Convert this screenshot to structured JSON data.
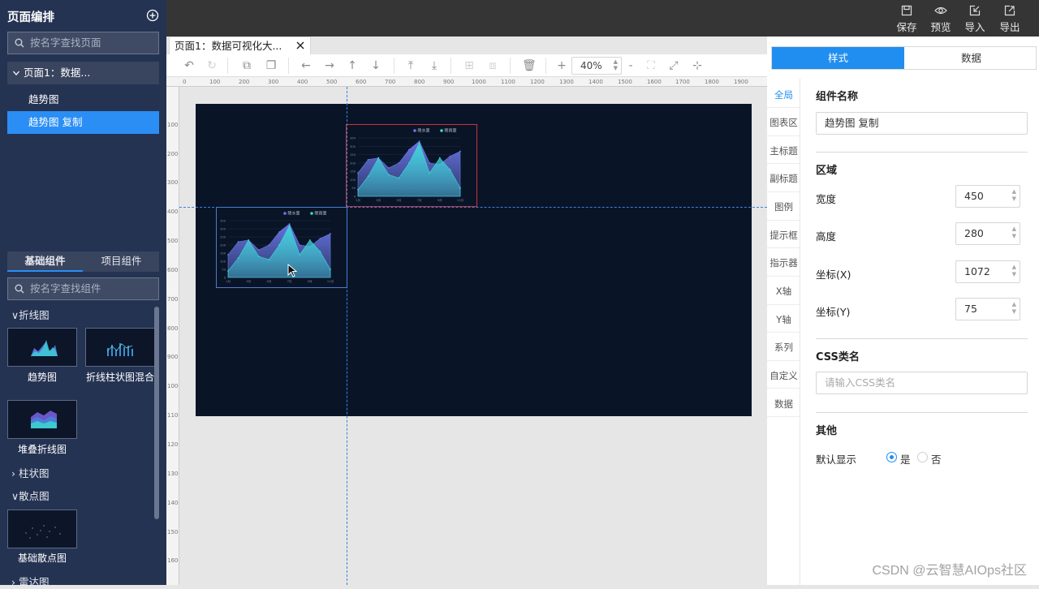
{
  "topbar": {
    "actions": [
      {
        "label": "保存",
        "icon": "save-icon"
      },
      {
        "label": "预览",
        "icon": "eye-icon"
      },
      {
        "label": "导入",
        "icon": "import-icon"
      },
      {
        "label": "导出",
        "icon": "export-icon"
      }
    ]
  },
  "left_panel": {
    "title": "页面编排",
    "page_search_placeholder": "按名字查找页面",
    "page_tree": {
      "page_label": "页面1：数据...",
      "items": [
        {
          "label": "趋势图",
          "selected": false
        },
        {
          "label": "趋势图 复制",
          "selected": true
        }
      ]
    },
    "component_tabs": [
      {
        "label": "基础组件",
        "active": true
      },
      {
        "label": "项目组件",
        "active": false
      }
    ],
    "component_search_placeholder": "按名字查找组件",
    "categories": {
      "line": "折线图",
      "bar": "柱状图",
      "scatter": "散点图",
      "radar": "雷达图"
    },
    "components": {
      "trend": "趋势图",
      "line_bar_mix": "折线柱状图混合",
      "stacked_line": "堆叠折线图",
      "basic_scatter": "基础散点图"
    }
  },
  "editor": {
    "tab_title": "页面1：数据可视化大...",
    "zoom": "40%",
    "ruler_h": [
      "0",
      "100",
      "200",
      "300",
      "400",
      "500",
      "600",
      "700",
      "800",
      "900",
      "1000",
      "1100",
      "1200",
      "1300",
      "1400",
      "1500",
      "1600",
      "1700",
      "1800",
      "1900"
    ],
    "ruler_v": [
      "100",
      "200",
      "300",
      "400",
      "500",
      "600",
      "700",
      "800",
      "900",
      "1000",
      "1100",
      "1200",
      "1300",
      "1400",
      "1500",
      "1600"
    ],
    "chart_legend": [
      "降水量",
      "降雨量"
    ]
  },
  "chart_data": [
    {
      "type": "area",
      "x": [
        "1月",
        "2月",
        "3月",
        "4月",
        "5月",
        "6月",
        "7月",
        "8月",
        "9月",
        "10月",
        "11月"
      ],
      "x_tick_labels": [
        "1月",
        "3月",
        "5月",
        "7月",
        "9月",
        "11月"
      ],
      "ylim": [
        0,
        350
      ],
      "yticks": [
        "0",
        "50",
        "100",
        "150",
        "200",
        "250",
        "300",
        "350"
      ],
      "legend_position": "top-right",
      "series": [
        {
          "name": "降水量",
          "color": "#6c78e8",
          "values": [
            140,
            220,
            230,
            170,
            200,
            280,
            330,
            200,
            190,
            240,
            270
          ]
        },
        {
          "name": "降雨量",
          "color": "#3fd6d9",
          "values": [
            40,
            120,
            230,
            130,
            110,
            200,
            320,
            140,
            230,
            160,
            50
          ]
        }
      ]
    }
  ],
  "right_panel": {
    "tabs": [
      {
        "label": "样式",
        "active": true
      },
      {
        "label": "数据",
        "active": false
      }
    ],
    "side_nav": [
      "全局",
      "图表区",
      "主标题",
      "副标题",
      "图例",
      "提示框",
      "指示器",
      "X轴",
      "Y轴",
      "系列",
      "自定义",
      "数据"
    ],
    "component_name_label": "组件名称",
    "component_name_value": "趋势图 复制",
    "area_title": "区域",
    "width_label": "宽度",
    "width_value": "450",
    "height_label": "高度",
    "height_value": "280",
    "x_label": "坐标(X)",
    "x_value": "1072",
    "y_label": "坐标(Y)",
    "y_value": "75",
    "css_title": "CSS类名",
    "css_placeholder": "请输入CSS类名",
    "other_title": "其他",
    "default_show_label": "默认显示",
    "yes_label": "是",
    "no_label": "否",
    "default_show": "是"
  },
  "watermark": "CSDN @云智慧AIOps社区"
}
